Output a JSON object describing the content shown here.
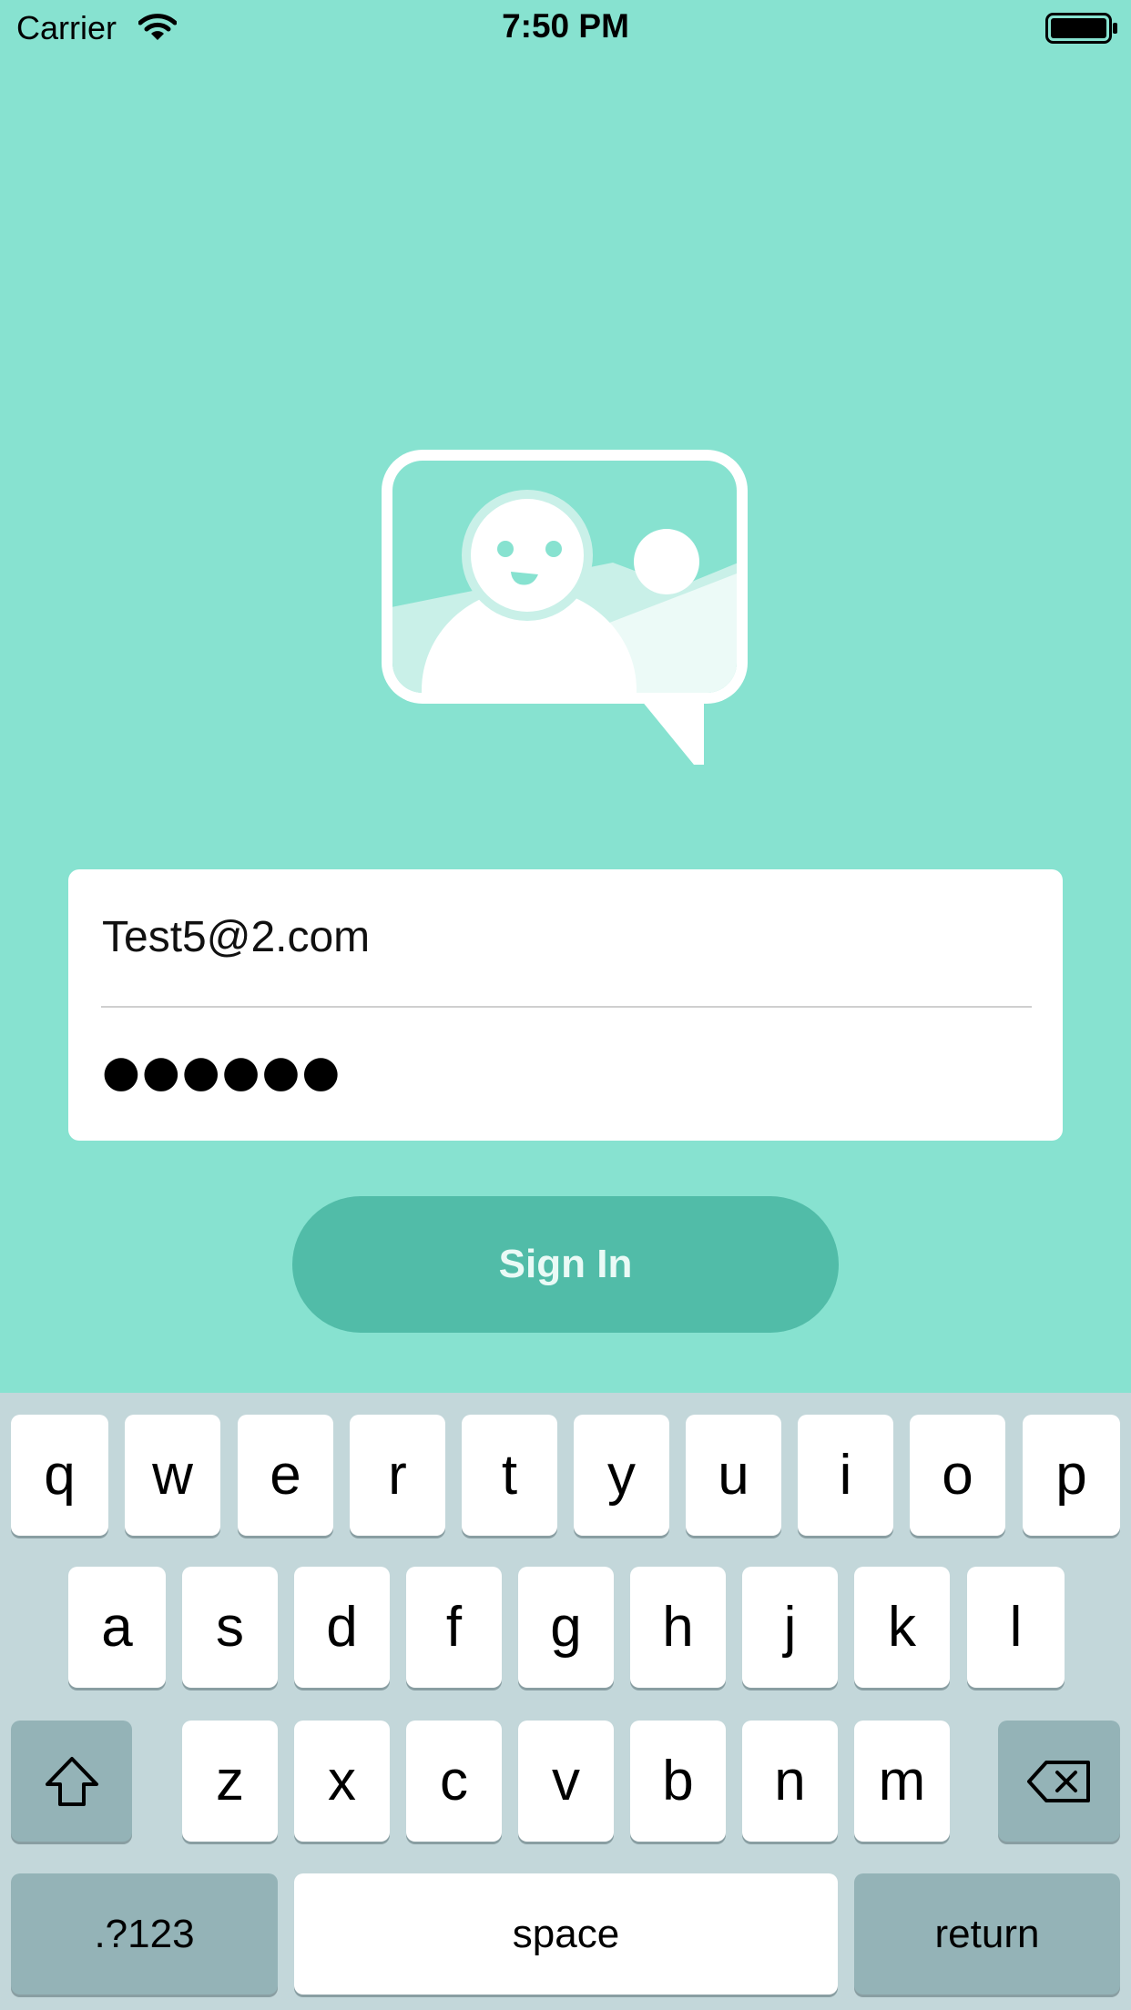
{
  "status_bar": {
    "carrier": "Carrier",
    "time": "7:50 PM",
    "wifi_icon": "wifi-icon",
    "battery_icon": "battery-icon"
  },
  "logo": {
    "icon": "photo-chat-bubble-icon"
  },
  "login_form": {
    "email_value": "Test5@2.com",
    "password_masked": "●●●●●●"
  },
  "sign_in_button": {
    "label": "Sign In"
  },
  "keyboard": {
    "row1": [
      "q",
      "w",
      "e",
      "r",
      "t",
      "y",
      "u",
      "i",
      "o",
      "p"
    ],
    "row2": [
      "a",
      "s",
      "d",
      "f",
      "g",
      "h",
      "j",
      "k",
      "l"
    ],
    "row3": [
      "z",
      "x",
      "c",
      "v",
      "b",
      "n",
      "m"
    ],
    "shift_icon": "shift-icon",
    "delete_icon": "delete-backspace-icon",
    "numbers_label": ".?123",
    "space_label": "space",
    "return_label": "return"
  },
  "colors": {
    "background": "#87e2d0",
    "button": "#51bca8",
    "keyboard_background": "#c3d7da",
    "special_key": "#94b3b7"
  }
}
